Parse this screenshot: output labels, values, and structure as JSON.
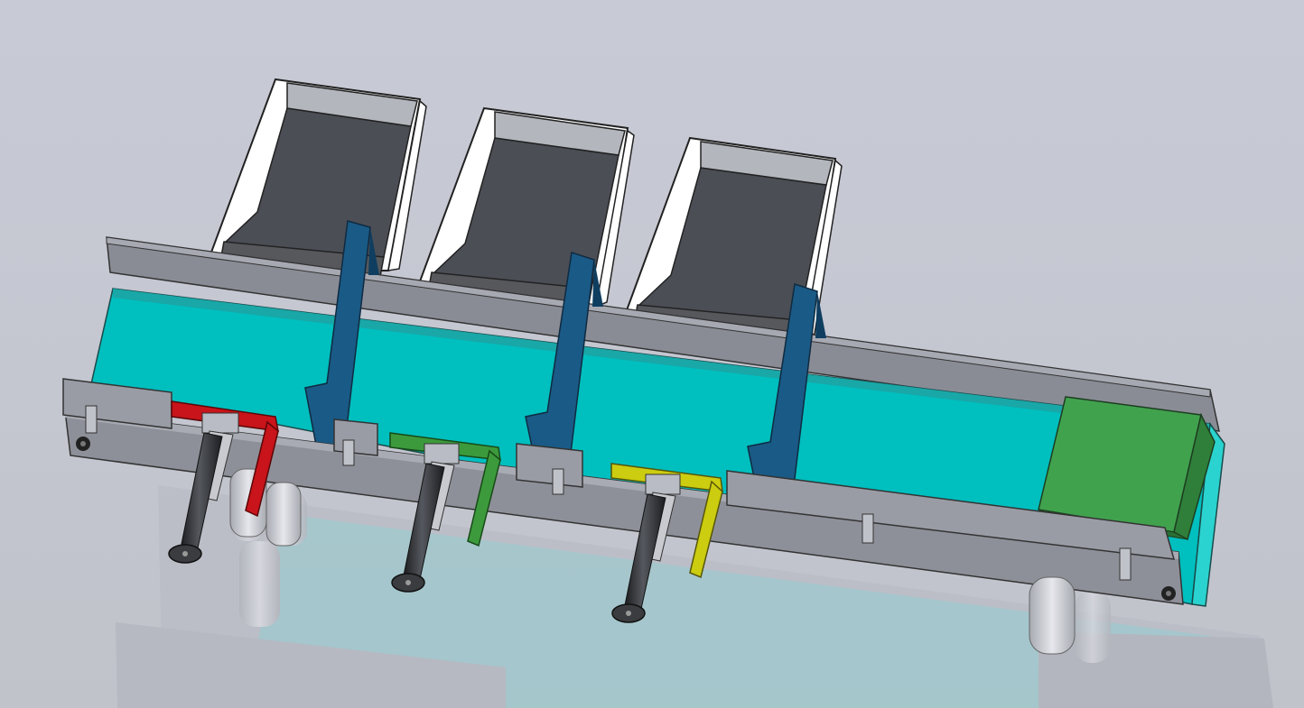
{
  "scene": {
    "kind": "cad-3d-model-render",
    "subject": "conveyor-sorting-station",
    "colors": {
      "background_top": "#c8cad6",
      "background_bottom": "#c2c4cc",
      "belt": "#00bfbf",
      "frame": "#8e9099",
      "frame_light": "#a9abb4",
      "hopper_inner": "#4a4d53",
      "hopper_outer": "#ffffff",
      "guide_bar": "#195a86",
      "pusher_red": "#c8141a",
      "pusher_green": "#3c9a3c",
      "pusher_yellow": "#cccc10",
      "box": "#3fa24d",
      "cylinder": "#303236"
    },
    "hoppers": [
      {
        "id": "hopper-1"
      },
      {
        "id": "hopper-2"
      },
      {
        "id": "hopper-3"
      }
    ],
    "guides": [
      {
        "id": "guide-1"
      },
      {
        "id": "guide-2"
      },
      {
        "id": "guide-3"
      }
    ],
    "pushers": [
      {
        "id": "pusher-red",
        "color": "red"
      },
      {
        "id": "pusher-green",
        "color": "green"
      },
      {
        "id": "pusher-yellow",
        "color": "yellow"
      }
    ],
    "box_on_belt": {
      "color": "green"
    }
  }
}
